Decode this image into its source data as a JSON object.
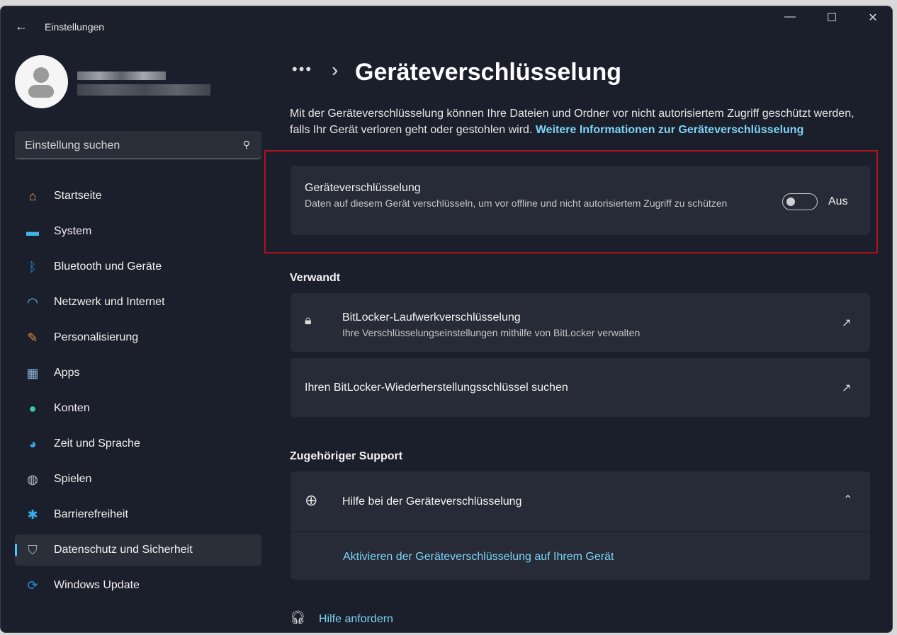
{
  "window": {
    "title": "Einstellungen"
  },
  "search": {
    "placeholder": "Einstellung suchen"
  },
  "nav": [
    {
      "label": "Startseite",
      "icon": "home-icon",
      "glyph": "⌂",
      "color": "#e8a070"
    },
    {
      "label": "System",
      "icon": "system-icon",
      "glyph": "▬",
      "color": "#3fb6e8"
    },
    {
      "label": "Bluetooth und Geräte",
      "icon": "bluetooth-icon",
      "glyph": "ᛒ",
      "color": "#2a8ce0"
    },
    {
      "label": "Netzwerk und Internet",
      "icon": "wifi-icon",
      "glyph": "◠",
      "color": "#4cc2ff"
    },
    {
      "label": "Personalisierung",
      "icon": "brush-icon",
      "glyph": "✎",
      "color": "#e09040"
    },
    {
      "label": "Apps",
      "icon": "apps-icon",
      "glyph": "▦",
      "color": "#8fb0d8"
    },
    {
      "label": "Konten",
      "icon": "account-icon",
      "glyph": "●",
      "color": "#3cc8a0"
    },
    {
      "label": "Zeit und Sprache",
      "icon": "globe-clock-icon",
      "glyph": "◕",
      "color": "#3ab0e8"
    },
    {
      "label": "Spielen",
      "icon": "gamepad-icon",
      "glyph": "◍",
      "color": "#b8bcc8"
    },
    {
      "label": "Barrierefreiheit",
      "icon": "accessibility-icon",
      "glyph": "✱",
      "color": "#3ab0f0"
    },
    {
      "label": "Datenschutz und Sicherheit",
      "icon": "shield-icon",
      "glyph": "⛉",
      "color": "#a8acb4",
      "active": true
    },
    {
      "label": "Windows Update",
      "icon": "update-icon",
      "glyph": "⟳",
      "color": "#2a8ce0"
    }
  ],
  "header": {
    "crumb": "•••",
    "sep": "›",
    "title": "Geräteverschlüsselung"
  },
  "description": {
    "text": "Mit der Geräteverschlüsselung können Ihre Dateien und Ordner vor nicht autorisiertem Zugriff geschützt werden, falls Ihr Gerät verloren geht oder gestohlen wird.",
    "link": "Weitere Informationen zur Geräteverschlüsselung"
  },
  "setting": {
    "title": "Geräteverschlüsselung",
    "subtitle": "Daten auf diesem Gerät verschlüsseln, um vor offline und nicht autorisiertem Zugriff zu schützen",
    "state": "Aus",
    "on": false
  },
  "related": {
    "heading": "Verwandt",
    "items": [
      {
        "title": "BitLocker-Laufwerkverschlüsselung",
        "subtitle": "Ihre Verschlüsselungseinstellungen mithilfe von BitLocker verwalten"
      },
      {
        "title": "Ihren BitLocker-Wiederherstellungsschlüssel suchen"
      }
    ]
  },
  "support": {
    "heading": "Zugehöriger Support",
    "title": "Hilfe bei der Geräteverschlüsselung",
    "link": "Aktivieren der Geräteverschlüsselung auf Ihrem Gerät"
  },
  "help": {
    "label": "Hilfe anfordern"
  }
}
